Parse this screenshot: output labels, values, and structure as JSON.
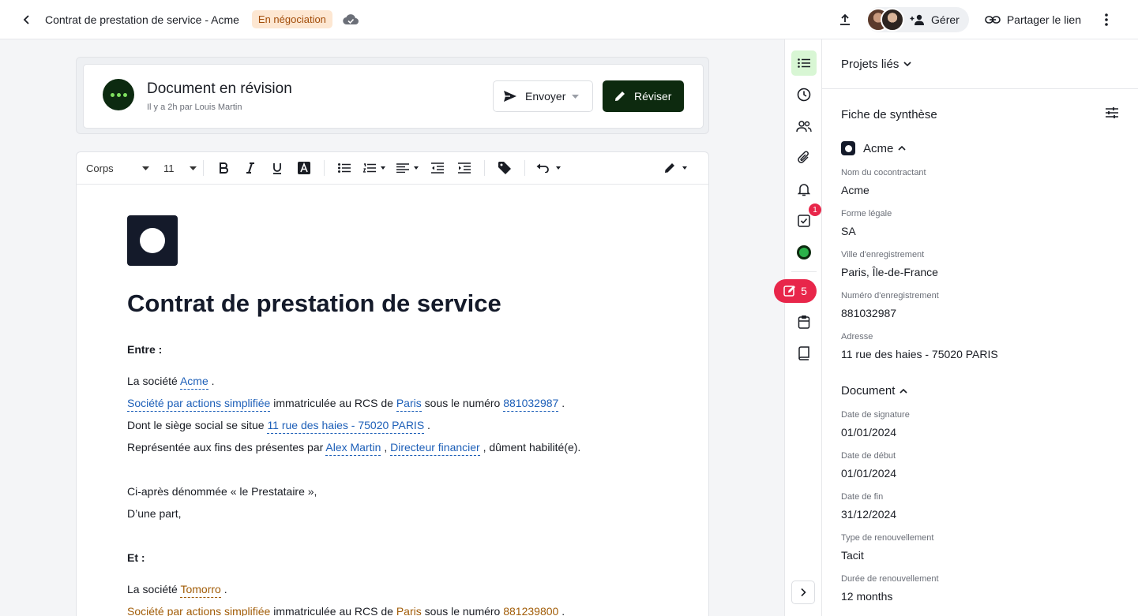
{
  "header": {
    "doc_title": "Contrat de prestation de service - Acme",
    "status": "En négociation",
    "manage_label": "Gérer",
    "share_label": "Partager le lien"
  },
  "revision": {
    "title": "Document en révision",
    "subtitle": "Il y a 2h par Louis Martin",
    "send_label": "Envoyer",
    "revise_label": "Réviser"
  },
  "toolbar": {
    "style_value": "Corps",
    "size_value": "11"
  },
  "document": {
    "heading": "Contrat de prestation de service",
    "between": "Entre :",
    "p1_prefix": "La société",
    "p1_company": "Acme",
    "p1_suffix": ".",
    "p2_legal": "Société par actions simplifiée",
    "p2_mid": "immatriculée au RCS de",
    "p2_city": "Paris",
    "p2_mid2": "sous le numéro",
    "p2_number": "881032987",
    "p2_suffix": ".",
    "p3_prefix": "Dont le siège social se situe",
    "p3_address": "11 rue des haies - 75020 PARIS",
    "p3_suffix": ".",
    "p4_prefix": "Représentée aux fins des présentes par",
    "p4_person": "Alex Martin",
    "p4_comma": ",",
    "p4_role": "Directeur financier",
    "p4_suffix": ", dûment habilité(e).",
    "p5": "Ci-après dénommée « le Prestataire »,",
    "p6": "D’une part,",
    "and": "Et :",
    "p7_prefix": "La société",
    "p7_company": "Tomorro",
    "p7_suffix": ".",
    "p8_legal": "Société par actions simplifiée",
    "p8_mid": "immatriculée au RCS de",
    "p8_city": "Paris",
    "p8_mid2": "sous le numéro",
    "p8_number": "881239800",
    "p8_suffix": "."
  },
  "rail": {
    "tasks_badge": "1",
    "edits_count": "5"
  },
  "panel": {
    "linked_projects": "Projets liés",
    "summary_title": "Fiche de synthèse",
    "acme_section": "Acme",
    "acme_fields": [
      {
        "label": "Nom du cocontractant",
        "value": "Acme"
      },
      {
        "label": "Forme légale",
        "value": "SA"
      },
      {
        "label": "Ville d'enregistrement",
        "value": "Paris, Île-de-France"
      },
      {
        "label": "Numéro d'enregistrement",
        "value": "881032987"
      },
      {
        "label": "Adresse",
        "value": "11 rue des haies - 75020 PARIS"
      }
    ],
    "document_section": "Document",
    "document_fields": [
      {
        "label": "Date de signature",
        "value": "01/01/2024"
      },
      {
        "label": "Date de début",
        "value": "01/01/2024"
      },
      {
        "label": "Date de fin",
        "value": "31/12/2024"
      },
      {
        "label": "Type de renouvellement",
        "value": "Tacit"
      },
      {
        "label": "Durée de renouvellement",
        "value": "12 months"
      }
    ]
  },
  "colors": {
    "accent_dark": "#0d2a0f",
    "accent_green": "#7ee05f",
    "status_bg": "#fde7d2",
    "status_text": "#a24d0a",
    "alert_red": "#e8264a",
    "var_blue": "#1d5fb8",
    "var_orange": "#a15c07"
  }
}
